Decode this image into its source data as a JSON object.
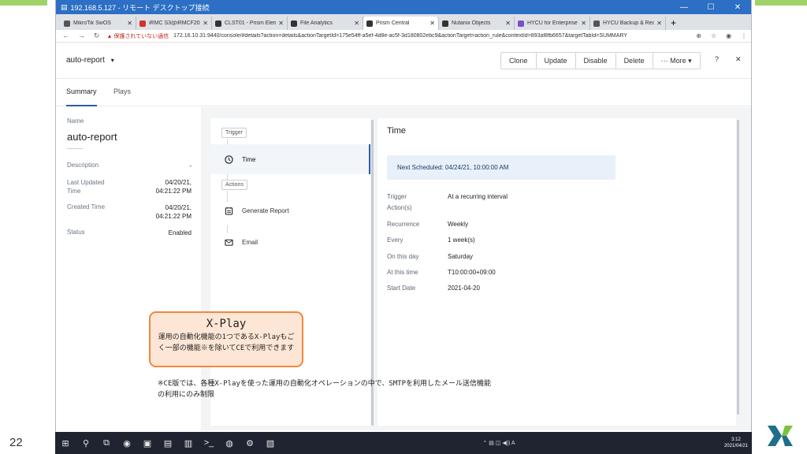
{
  "slide": {
    "number": "22"
  },
  "rd_window": {
    "title": "192.168.5.127 - リモート デスクトップ接続",
    "controls": [
      "—",
      "☐",
      "✕"
    ]
  },
  "browser": {
    "tabs": [
      {
        "label": "MikroTik SwOS",
        "color": "#555555"
      },
      {
        "label": "iRMC S3@iRMCF2058",
        "color": "#d93025"
      },
      {
        "label": "CLST01 - Prism Element",
        "color": "#333333"
      },
      {
        "label": "File Analytics",
        "color": "#333333"
      },
      {
        "label": "Prism Central",
        "color": "#333333",
        "active": true
      },
      {
        "label": "Nutanix Objects",
        "color": "#333333"
      },
      {
        "label": "HYCU for Enterprise C",
        "color": "#7b4fc8"
      },
      {
        "label": "HYCU Backup & Recov",
        "color": "#555555"
      }
    ],
    "close_glyph": "✕",
    "new_tab": "+",
    "warning": "▲ 保護されていない通信",
    "url": "172.16.10.31:9440/console/#details?action=details&actionTargetId=175e54ff-a5ef-4d8e-ac5f-3d180802ebc9&actionTarget=action_rule&contextId=893af8fb6657&targetTabId=SUMMARY",
    "nav": [
      "←",
      "→",
      "↻"
    ],
    "tools": [
      "⊕",
      "☆",
      "◉",
      "⋮"
    ]
  },
  "app": {
    "entity_label": "auto-report",
    "entity_caret": "▾",
    "actions": [
      "Clone",
      "Update",
      "Disable",
      "Delete",
      "··· More ▾"
    ],
    "help": "?",
    "close": "✕",
    "subtabs": [
      "Summary",
      "Plays"
    ]
  },
  "summary": {
    "name_label": "Name",
    "name_value": "auto-report",
    "rows": [
      {
        "label": "Description",
        "value": "-"
      },
      {
        "label": "Last Updated\nTime",
        "value": "04/20/21,\n04:21:22 PM"
      },
      {
        "label": "Created Time",
        "value": "04/20/21,\n04:21:22 PM"
      },
      {
        "label": "Status",
        "value": "Enabled"
      }
    ]
  },
  "steps": {
    "trigger_pill": "Trigger",
    "actions_pill": "Actions",
    "items": [
      {
        "label": "Time",
        "icon": "clock-icon",
        "active": true
      },
      {
        "label": "Generate Report",
        "icon": "report-icon",
        "active": false
      },
      {
        "label": "Email",
        "icon": "email-icon",
        "active": false
      }
    ]
  },
  "detail": {
    "title": "Time",
    "next_scheduled": "Next Scheduled: 04/24/21, 10:00:00 AM",
    "rows": [
      {
        "label": "Trigger\nAction(s)",
        "value": "At a recurring interval"
      },
      {
        "label": "Recurrence",
        "value": "Weekly"
      },
      {
        "label": "Every",
        "value": "1 week(s)"
      },
      {
        "label": "On this day",
        "value": "Saturday"
      },
      {
        "label": "At this time",
        "value": "T10:00:00+09:00"
      },
      {
        "label": "Start Date",
        "value": "2021-04-20"
      }
    ]
  },
  "callout": {
    "title": "X-Play",
    "body": "運用の自動化機能の1つであるX-Playもごく一部の機能※を除いてCEで利用できます"
  },
  "note": "※CE版では、各種X-Playを使った運用の自動化オペレーションの中で、SMTPを利用したメール送信機能の利用にのみ制限",
  "taskbar": {
    "items": [
      "⊞",
      "⚲",
      "⧉",
      "◉",
      "▣",
      "▤",
      "▥",
      ">_",
      "◍",
      "⚙",
      "▧"
    ],
    "tray": "⌃ ▤ ◫ ◀)) A",
    "time": "3:12",
    "date": "2021/04/21"
  }
}
